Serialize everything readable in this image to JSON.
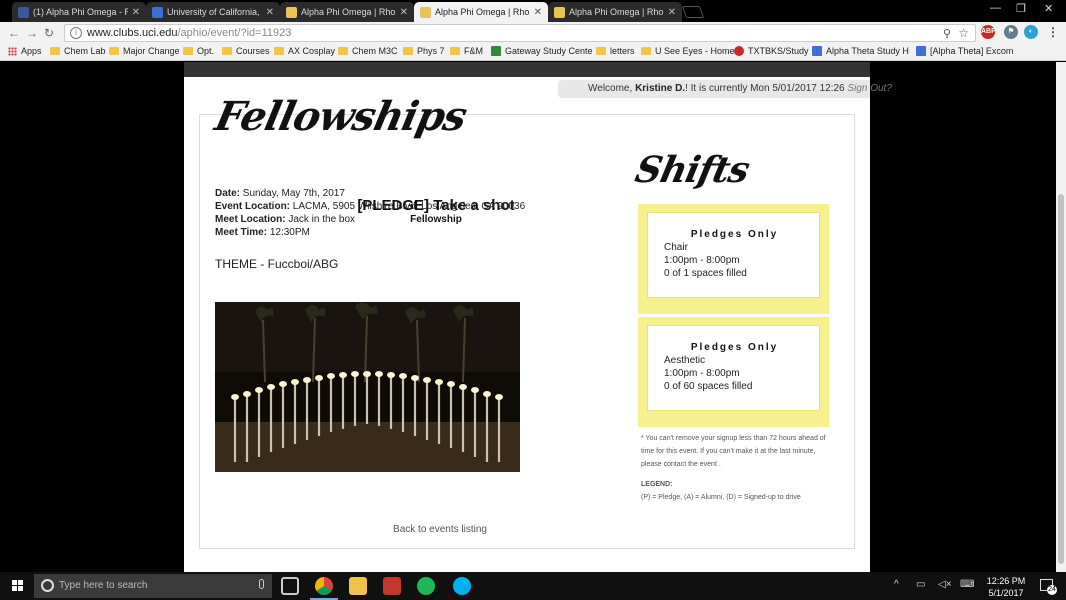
{
  "browser": {
    "tabs": [
      {
        "title": "(1) Alpha Phi Omega - RI",
        "favicon_color": "#3b5998",
        "active": false
      },
      {
        "title": "University of California, I",
        "favicon_color": "#3a6fd8",
        "active": false
      },
      {
        "title": "Alpha Phi Omega | Rho P",
        "favicon_color": "#e5c452",
        "active": false
      },
      {
        "title": "Alpha Phi Omega | Rho P",
        "favicon_color": "#e5c452",
        "active": true
      },
      {
        "title": "Alpha Phi Omega | Rho P",
        "favicon_color": "#e5c452",
        "active": false
      }
    ],
    "url_host": "www.clubs.uci.edu",
    "url_path": "/aphio/event/?id=11923",
    "bookmarks": [
      {
        "label": "Apps",
        "kind": "apps"
      },
      {
        "label": "Chem Lab",
        "kind": "folder"
      },
      {
        "label": "Major Change",
        "kind": "folder"
      },
      {
        "label": "Opt.",
        "kind": "folder"
      },
      {
        "label": "Courses",
        "kind": "folder"
      },
      {
        "label": "AX Cosplay",
        "kind": "folder"
      },
      {
        "label": "Chem M3C",
        "kind": "folder"
      },
      {
        "label": "Phys 7",
        "kind": "folder"
      },
      {
        "label": "F&M",
        "kind": "folder"
      },
      {
        "label": "Gateway Study Cente",
        "kind": "site",
        "color": "#2e8b3a"
      },
      {
        "label": "letters",
        "kind": "folder"
      },
      {
        "label": "U See Eyes - Home",
        "kind": "folder"
      },
      {
        "label": "TXTBKS/Study",
        "kind": "site",
        "color": "#c62828"
      },
      {
        "label": "Alpha Theta Study H",
        "kind": "site",
        "color": "#3f6fd6"
      },
      {
        "label": "[Alpha Theta] Excom",
        "kind": "site",
        "color": "#3f6fd6"
      }
    ]
  },
  "page": {
    "welcome_prefix": "Welcome, ",
    "user_name": "Kristine D.",
    "welcome_mid": "! It is currently Mon 5/01/2017 12:26 ",
    "sign_out": "Sign Out?",
    "section_title": "Fellowships",
    "event_title": "[PLEDGE] Take a shot",
    "event_category": "Fellowship",
    "details": [
      {
        "label": "Date:",
        "value": "Sunday, May 7th, 2017"
      },
      {
        "label": "Event Location:",
        "value": "LACMA, 5905 Wilshire Blvd, Los Angeles, CA 90036"
      },
      {
        "label": "Meet Location:",
        "value": "Jack in the box"
      },
      {
        "label": "Meet Time:",
        "value": "12:30PM"
      }
    ],
    "theme": "THEME - Fuccboi/ABG",
    "back_link": "Back to events listing",
    "shifts_title": "Shifts",
    "shifts": [
      {
        "title": "Pledges Only",
        "role": "Chair",
        "time": "1:00pm - 8:00pm",
        "filled": "0 of 1 spaces filled"
      },
      {
        "title": "Pledges Only",
        "role": "Aesthetic",
        "time": "1:00pm - 8:00pm",
        "filled": "0 of 60 spaces filled"
      }
    ],
    "note_lines": [
      "* You can't remove your signup less than 72 hours ahead of",
      "time for this event. If you can't make it at the last minute,",
      "please contact the event ."
    ],
    "legend_heading": "LEGEND:",
    "legend_text": "(P) = Pledge, (A) = Alumni, (D) = Signed-up to drive"
  },
  "taskbar": {
    "search_placeholder": "Type here to search",
    "time": "12:26 PM",
    "date": "5/1/2017",
    "notification_count": "24"
  }
}
